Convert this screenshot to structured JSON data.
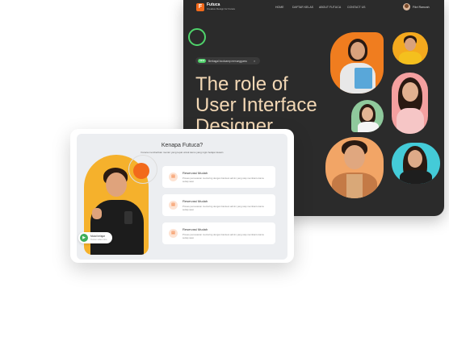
{
  "nav": {
    "logo_letter": "F",
    "brand": "Futuca",
    "tagline": "Creative Design for Future",
    "links": [
      "HOME",
      "DAFTAR KELAS",
      "ABOUT FUTUCA",
      "CONTACT US"
    ],
    "user": "Fikri Ramzah"
  },
  "hero": {
    "pill_tag": "NEW",
    "pill_text": "Berbagai bootcamp menunggumu",
    "pill_close": "×",
    "title_lines": [
      "The role of",
      "User Interface",
      "Designer"
    ]
  },
  "colors": {
    "dark_bg": "#2b2b2b",
    "accent_orange": "#f26a1b",
    "accent_green": "#4fd36b",
    "hero_text": "#f3d8b5",
    "light_bg": "#eceef1"
  },
  "why": {
    "title": "Kenapa Futuca?",
    "subtitle": "Futuca memberikan mentor yang tepat untuk kamu yang ingin belajar desain",
    "play_title": "Mulai belajar",
    "play_sub": "Tonton video intro",
    "play_icon": "play-icon",
    "features": [
      {
        "icon": "document-icon",
        "title": "Reservasi Mudah",
        "desc": "Proses pemesanan mentoring dengan bantuan admin yang siap membantu kamu setiap saat."
      },
      {
        "icon": "document-icon",
        "title": "Reservasi Mudah",
        "desc": "Proses pemesanan mentoring dengan bantuan admin yang siap membantu kamu setiap saat."
      },
      {
        "icon": "document-icon",
        "title": "Reservasi Mudah",
        "desc": "Proses pemesanan mentoring dengan bantuan admin yang siap membantu kamu setiap saat."
      }
    ]
  }
}
